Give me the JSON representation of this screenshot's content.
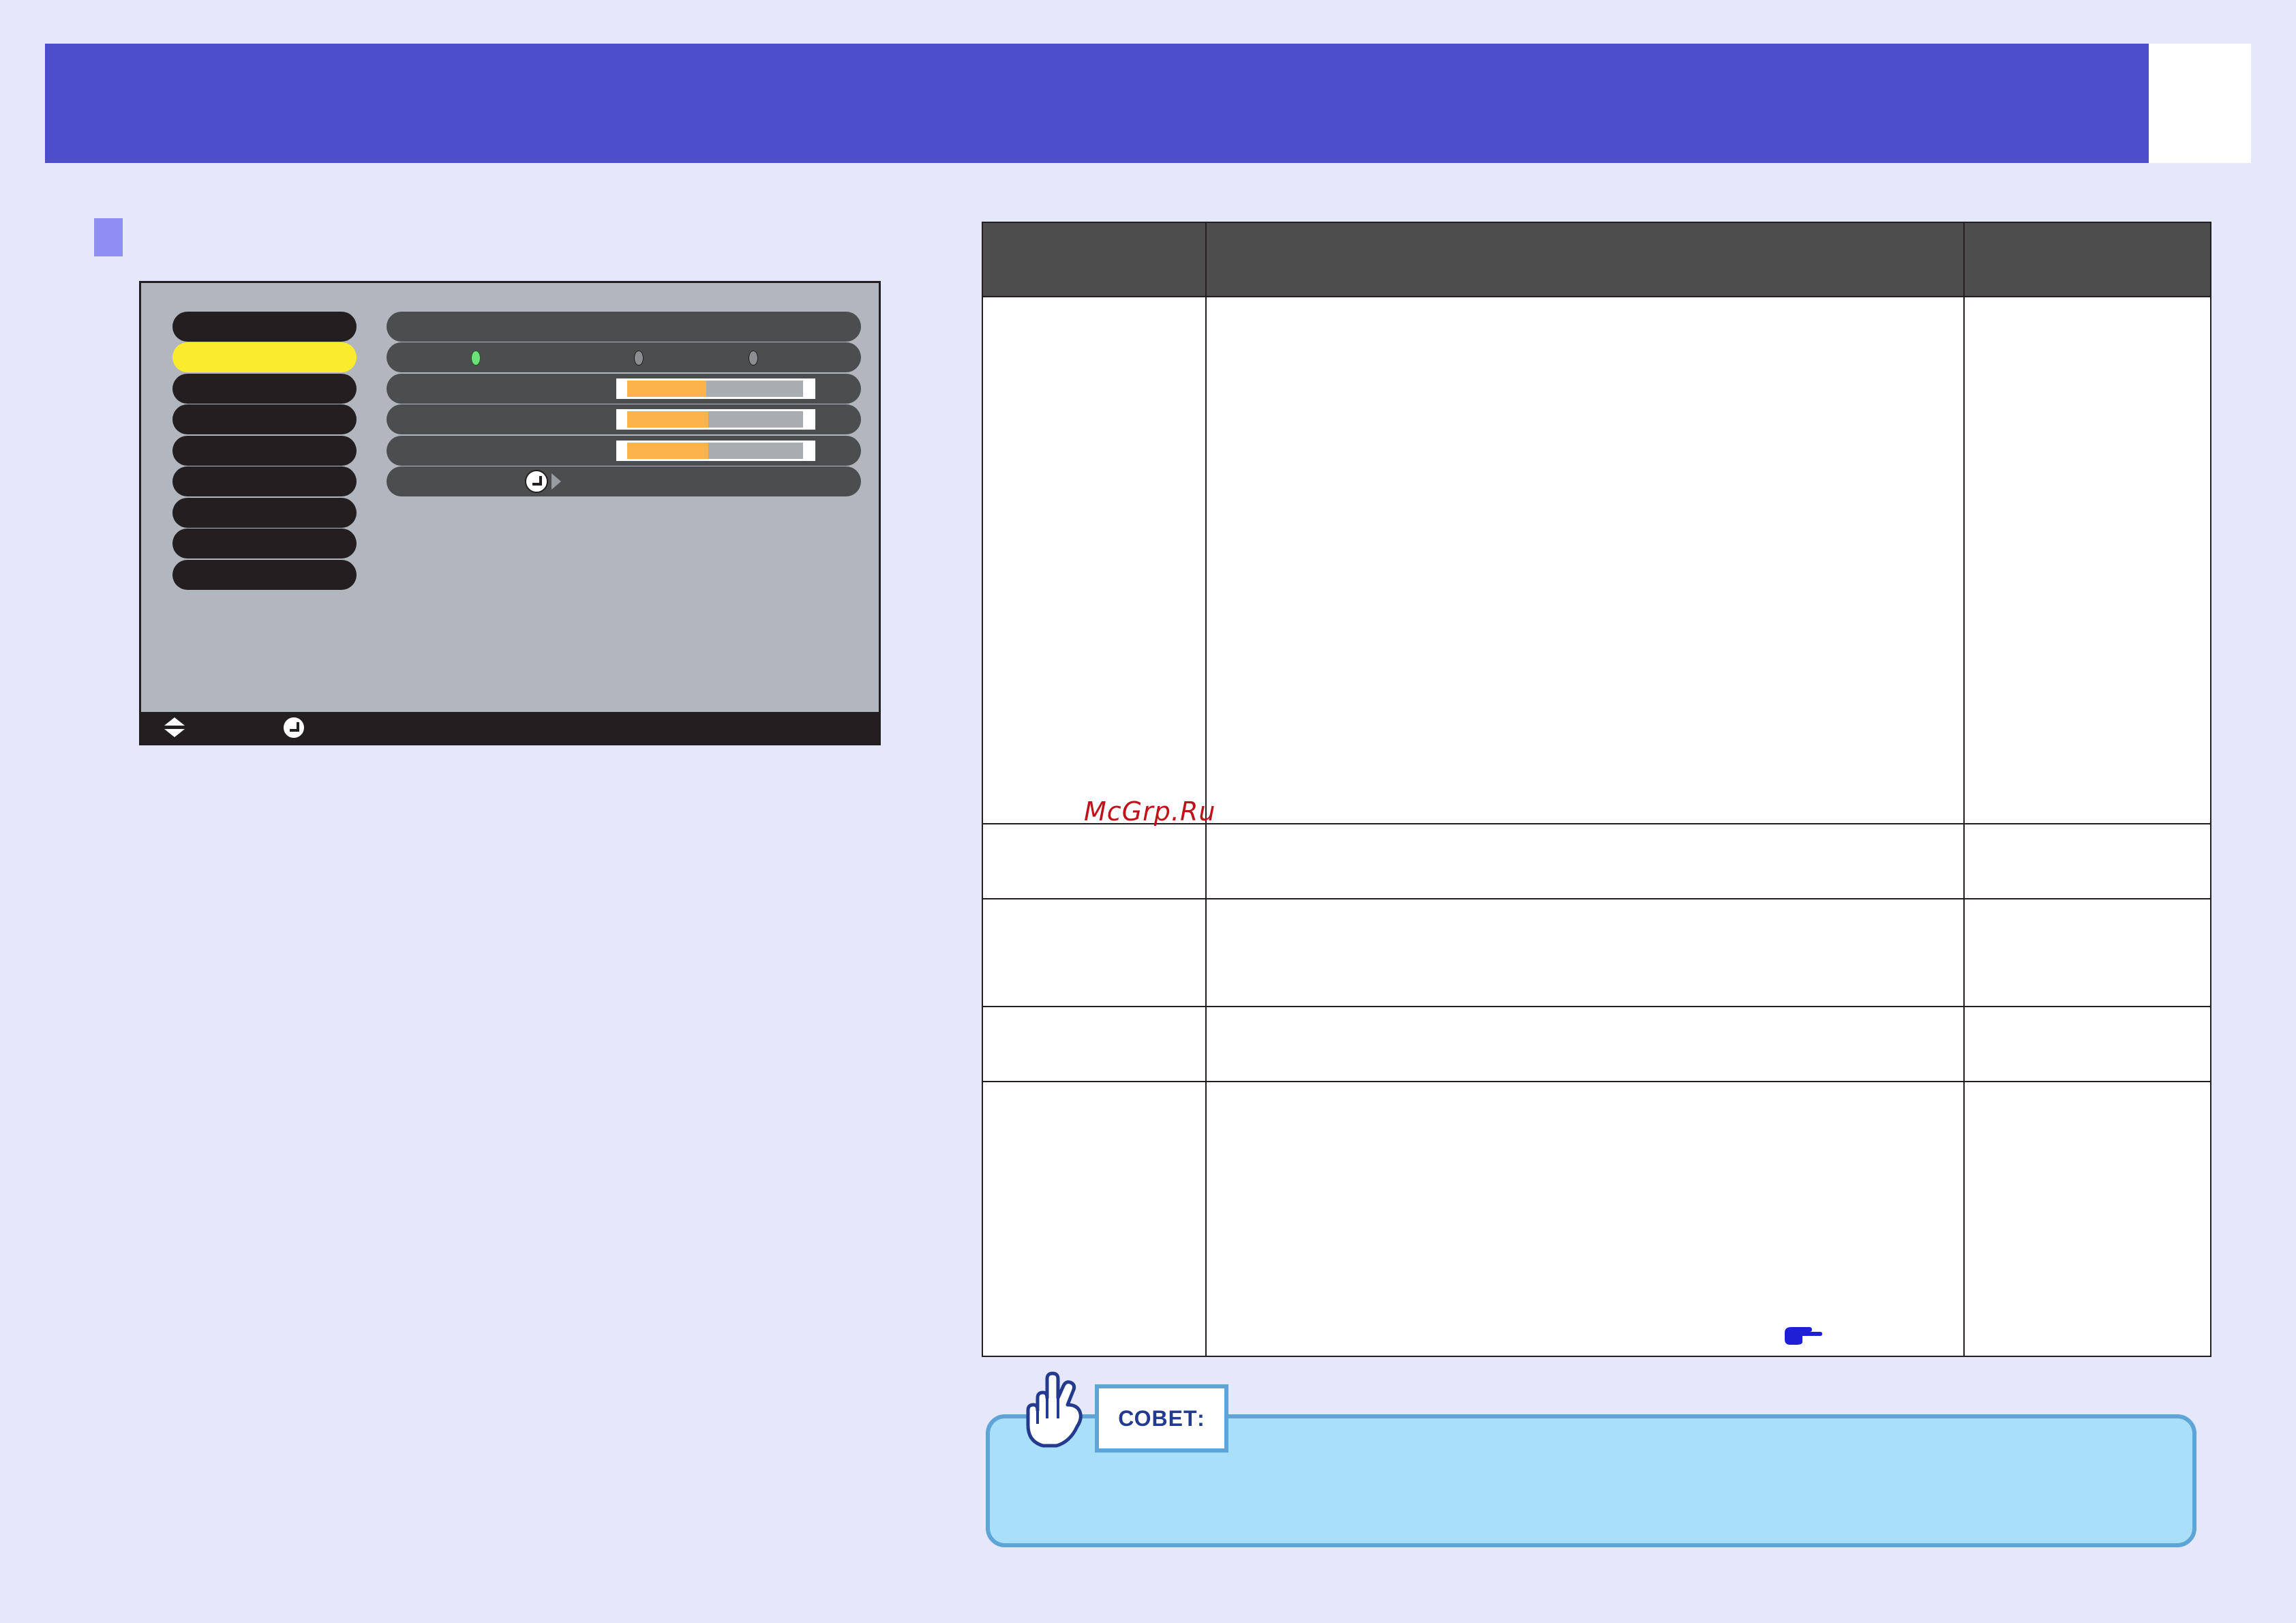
{
  "header": {
    "title": "",
    "page_number": ""
  },
  "osd_menu": {
    "menu_items": [
      "",
      "",
      "",
      "",
      "",
      "",
      "",
      "",
      ""
    ],
    "selected_index": 1,
    "radio_options_selected": 0,
    "slider_levels": [
      0.45,
      0.46,
      0.46
    ]
  },
  "watermark": {
    "text": "McGrp.Ru"
  },
  "tip": {
    "label": "СОВЕТ:"
  },
  "colors": {
    "header_bar": "#4d4fca",
    "menu_selected": "#fbeb2f",
    "slider_fill": "#fdb34c",
    "radio_on": "#6ee07a",
    "tip_background": "#a9dff9",
    "tip_border": "#5ea4d6",
    "table_header": "#4d4d4d"
  },
  "icons": [
    "enter-icon",
    "arrow-right-icon",
    "up-down-icon",
    "pointing-hand-icon",
    "hand-tip-icon"
  ]
}
